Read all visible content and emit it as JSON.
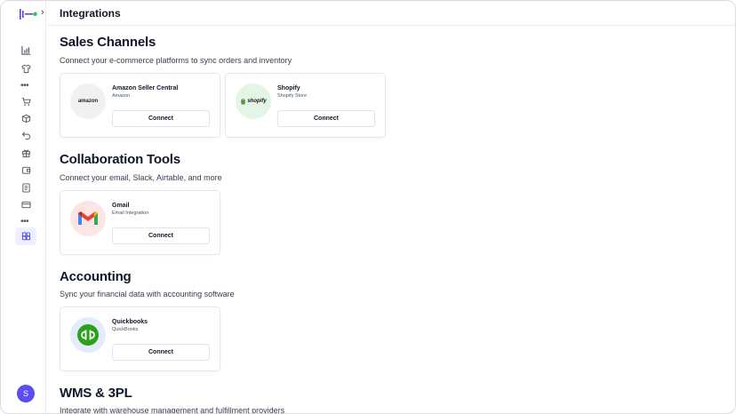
{
  "header": {
    "title": "Integrations"
  },
  "sidebar": {
    "icons": [
      "bar-chart-icon",
      "shirt-icon",
      "more-dots-icon",
      "cart-icon",
      "box-icon",
      "return-icon",
      "gift-icon",
      "wallet-icon",
      "document-icon",
      "credit-card-icon",
      "more-dots-icon",
      "integrations-icon"
    ],
    "avatar_initial": "S"
  },
  "sections": [
    {
      "title": "Sales Channels",
      "description": "Connect your e-commerce platforms to sync orders and inventory",
      "cards": [
        {
          "name": "Amazon Seller Central",
          "subtitle": "Amazon",
          "button": "Connect",
          "logo_text": "amazon",
          "logo_bg": "#f1f1f3"
        },
        {
          "name": "Shopify",
          "subtitle": "Shopify Store",
          "button": "Connect",
          "logo_text": "shopify",
          "logo_bg": "#e3f6e6"
        }
      ]
    },
    {
      "title": "Collaboration Tools",
      "description": "Connect your email, Slack, Airtable, and more",
      "cards": [
        {
          "name": "Gmail",
          "subtitle": "Email Integration",
          "button": "Connect",
          "logo_bg": "#fde5e5"
        }
      ]
    },
    {
      "title": "Accounting",
      "description": "Sync your financial data with accounting software",
      "cards": [
        {
          "name": "Quickbooks",
          "subtitle": "QuickBooks",
          "button": "Connect",
          "logo_bg": "#e2ecfa"
        }
      ]
    },
    {
      "title": "WMS & 3PL",
      "description": "Integrate with warehouse management and fulfillment providers",
      "cards": []
    }
  ],
  "colors": {
    "accent": "#5b4ef0",
    "active_nav_bg": "#eef0ff",
    "border": "#e6e7ea"
  }
}
